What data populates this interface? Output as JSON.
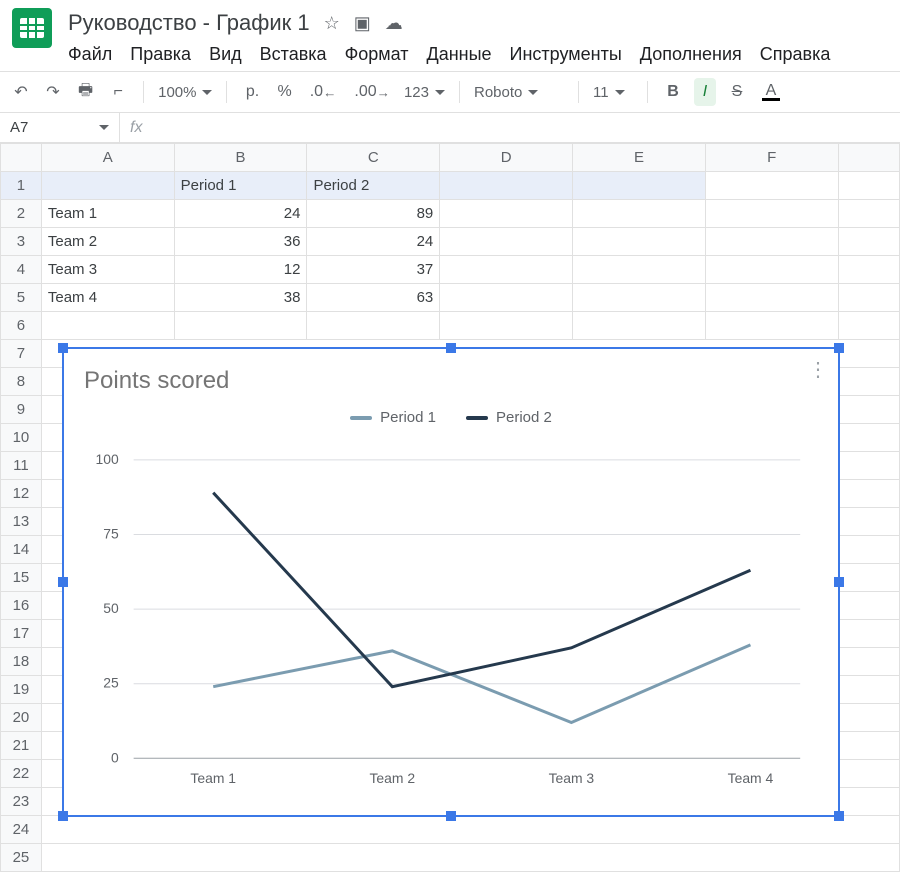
{
  "doc": {
    "title": "Руководство  - График 1"
  },
  "menus": [
    "Файл",
    "Правка",
    "Вид",
    "Вставка",
    "Формат",
    "Данные",
    "Инструменты",
    "Дополнения",
    "Справка"
  ],
  "toolbar": {
    "zoom": "100%",
    "currency": "р.",
    "percent": "%",
    "dec_less": ".0",
    "dec_more": ".00",
    "numfmt": "123",
    "font": "Roboto",
    "fontsize": "11",
    "bold": "B",
    "italic": "I",
    "strike": "S",
    "textcolor": "A"
  },
  "namebox": {
    "ref": "A7",
    "fx": "fx"
  },
  "columns": [
    "A",
    "B",
    "C",
    "D",
    "E",
    "F"
  ],
  "row_numbers": [
    1,
    2,
    3,
    4,
    5,
    6,
    7,
    8,
    9,
    10,
    11,
    12,
    13,
    14,
    15,
    16,
    17,
    18,
    19,
    20,
    21,
    22,
    23,
    24,
    25
  ],
  "table": {
    "headers": {
      "b": "Period 1",
      "c": "Period 2"
    },
    "rows": [
      {
        "a": "Team 1",
        "b": "24",
        "c": "89"
      },
      {
        "a": "Team 2",
        "b": "36",
        "c": "24"
      },
      {
        "a": "Team 3",
        "b": "12",
        "c": "37"
      },
      {
        "a": "Team 4",
        "b": "38",
        "c": "63"
      }
    ]
  },
  "chart": {
    "title": "Points scored",
    "legend": {
      "s1": "Period 1",
      "s2": "Period 2"
    },
    "yticks": [
      "0",
      "25",
      "50",
      "75",
      "100"
    ],
    "xticks": [
      "Team 1",
      "Team 2",
      "Team 3",
      "Team 4"
    ]
  },
  "chart_data": {
    "type": "line",
    "title": "Points scored",
    "categories": [
      "Team 1",
      "Team 2",
      "Team 3",
      "Team 4"
    ],
    "series": [
      {
        "name": "Period 1",
        "values": [
          24,
          36,
          12,
          38
        ],
        "color": "#7b9cb0"
      },
      {
        "name": "Period 2",
        "values": [
          89,
          24,
          37,
          63
        ],
        "color": "#25394d"
      }
    ],
    "xlabel": "",
    "ylabel": "",
    "ylim": [
      0,
      100
    ],
    "yticks": [
      0,
      25,
      50,
      75,
      100
    ]
  }
}
